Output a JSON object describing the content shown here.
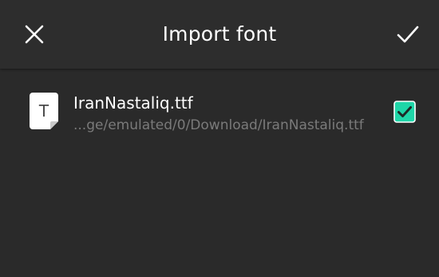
{
  "app_bar": {
    "title": "Import font",
    "close_icon": "close-icon",
    "confirm_icon": "check-icon"
  },
  "font_list": [
    {
      "file_icon": "font-file-icon",
      "file_icon_letter": "T",
      "name": "IranNastaliq.ttf",
      "path": "...ge/emulated/0/Download/IranNastaliq.ttf",
      "checked": true
    }
  ],
  "colors": {
    "background": "#2a2a2a",
    "app_bar": "#2d2d2d",
    "accent": "#1fd6a8",
    "primary_text": "#ffffff",
    "secondary_text": "#7a7a7a"
  }
}
